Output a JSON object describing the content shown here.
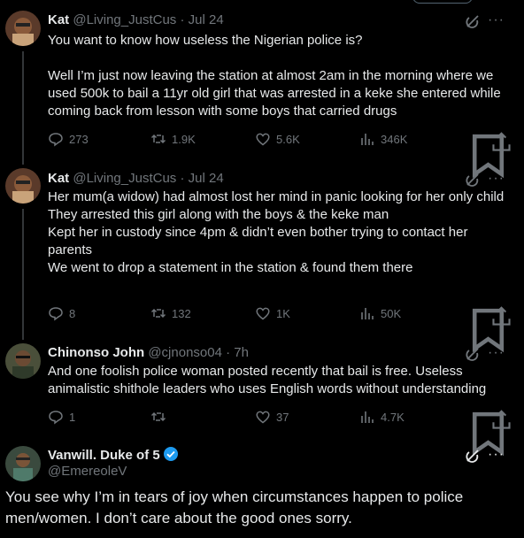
{
  "tweets": [
    {
      "name": "Kat",
      "handle": "@Living_JustCus",
      "time": "· Jul 24",
      "text": "You want to know how useless the Nigerian police is?\n\nWell I’m just now leaving the station at almost 2am in the morning where we used 500k to bail a 11yr old girl that was arrested in a keke she entered while coming back from lesson with some boys that carried drugs",
      "replies": "273",
      "reposts": "1.9K",
      "likes": "5.6K",
      "views": "346K"
    },
    {
      "name": "Kat",
      "handle": "@Living_JustCus",
      "time": "· Jul 24",
      "text": "Her mum(a widow) had almost lost her mind in panic looking for her only child\nThey arrested this girl along with the boys & the keke man\nKept her in custody since 4pm & didn’t even bother trying to contact her parents\nWe went to drop a statement in the station & found them there",
      "replies": "8",
      "reposts": "132",
      "likes": "1K",
      "views": "50K"
    },
    {
      "name": "Chinonso John",
      "handle": "@cjnonso04",
      "time": "· 7h",
      "text": "And one foolish police woman posted recently that bail is free. Useless animalistic shithole leaders who uses English words without understanding",
      "replies": "1",
      "reposts": "",
      "likes": "37",
      "views": "4.7K"
    }
  ],
  "main_tweet": {
    "name": "Vanwill. Duke of 5",
    "handle": "@EmereoleV",
    "text": "You see why I’m in tears of joy when circumstances happen to police men/women. I don’t care about the good ones sorry."
  },
  "icons": {
    "reply": "reply-icon",
    "repost": "repost-icon",
    "like": "like-icon",
    "views": "views-icon",
    "bookmark": "bookmark-icon",
    "share": "share-icon",
    "grok": "grok-icon",
    "more": "more-icon",
    "verified": "verified-badge-icon"
  },
  "colors": {
    "background": "#000000",
    "text": "#e7e9ea",
    "muted": "#71767b",
    "verified": "#1d9bf0"
  }
}
